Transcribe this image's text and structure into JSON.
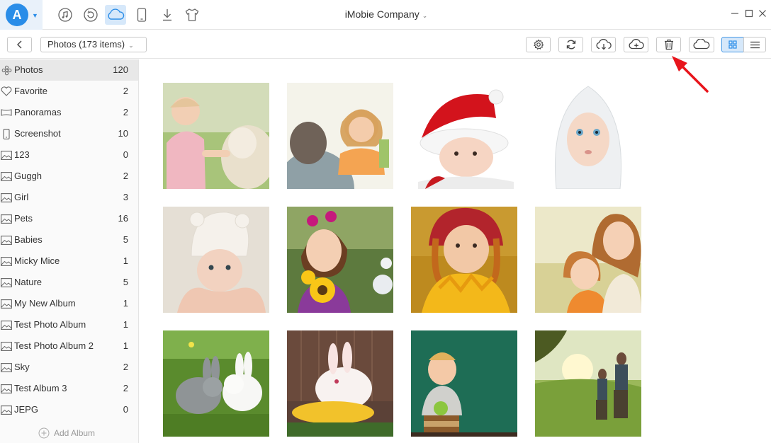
{
  "header": {
    "app_title": "iMobie Company",
    "logo_letter": "A",
    "icons": [
      "music-icon",
      "restore-icon",
      "cloud-icon",
      "phone-icon",
      "download-icon",
      "tshirt-icon"
    ]
  },
  "window_controls": [
    "minimize-icon",
    "maximize-icon",
    "close-icon"
  ],
  "toolbar": {
    "dropdown_label": "Photos (173 items)",
    "buttons": [
      "settings-icon",
      "refresh-icon",
      "cloud-download-icon",
      "cloud-upload-icon",
      "trash-icon",
      "cloud-icon"
    ],
    "views": [
      "grid-view-icon",
      "list-view-icon"
    ]
  },
  "sidebar": {
    "items": [
      {
        "label": "Photos",
        "count": "120",
        "icon": "flower-icon"
      },
      {
        "label": "Favorite",
        "count": "2",
        "icon": "heart-icon"
      },
      {
        "label": "Panoramas",
        "count": "2",
        "icon": "panorama-icon"
      },
      {
        "label": "Screenshot",
        "count": "10",
        "icon": "phone-icon"
      },
      {
        "label": "123",
        "count": "0",
        "icon": "album-icon"
      },
      {
        "label": "Guggh",
        "count": "2",
        "icon": "album-icon"
      },
      {
        "label": "Girl",
        "count": "3",
        "icon": "album-icon"
      },
      {
        "label": "Pets",
        "count": "16",
        "icon": "album-icon"
      },
      {
        "label": "Babies",
        "count": "5",
        "icon": "album-icon"
      },
      {
        "label": "Micky Mice",
        "count": "1",
        "icon": "album-icon"
      },
      {
        "label": "Nature",
        "count": "5",
        "icon": "album-icon"
      },
      {
        "label": "My New Album",
        "count": "1",
        "icon": "album-icon"
      },
      {
        "label": "Test Photo Album",
        "count": "1",
        "icon": "album-icon"
      },
      {
        "label": "Test Photo Album 2",
        "count": "1",
        "icon": "album-icon"
      },
      {
        "label": "Sky",
        "count": "2",
        "icon": "album-icon"
      },
      {
        "label": "Test Album 3",
        "count": "2",
        "icon": "album-icon"
      },
      {
        "label": "JEPG",
        "count": "0",
        "icon": "album-icon"
      }
    ],
    "add_album_label": "Add Album"
  },
  "photos": [
    "baby-with-dog",
    "girl-with-father",
    "baby-in-santa-hat",
    "baby-in-towel",
    "baby-in-bear-hat",
    "girl-with-sunflowers",
    "girl-with-autumn-leaves",
    "mother-and-daughter",
    "two-rabbits",
    "bunny-on-corn",
    "boy-with-apple",
    "hikers-in-field"
  ],
  "colors": {
    "accent": "#2a8de8",
    "selected_bg": "#e8e8e8",
    "arrow": "#e8151c"
  }
}
